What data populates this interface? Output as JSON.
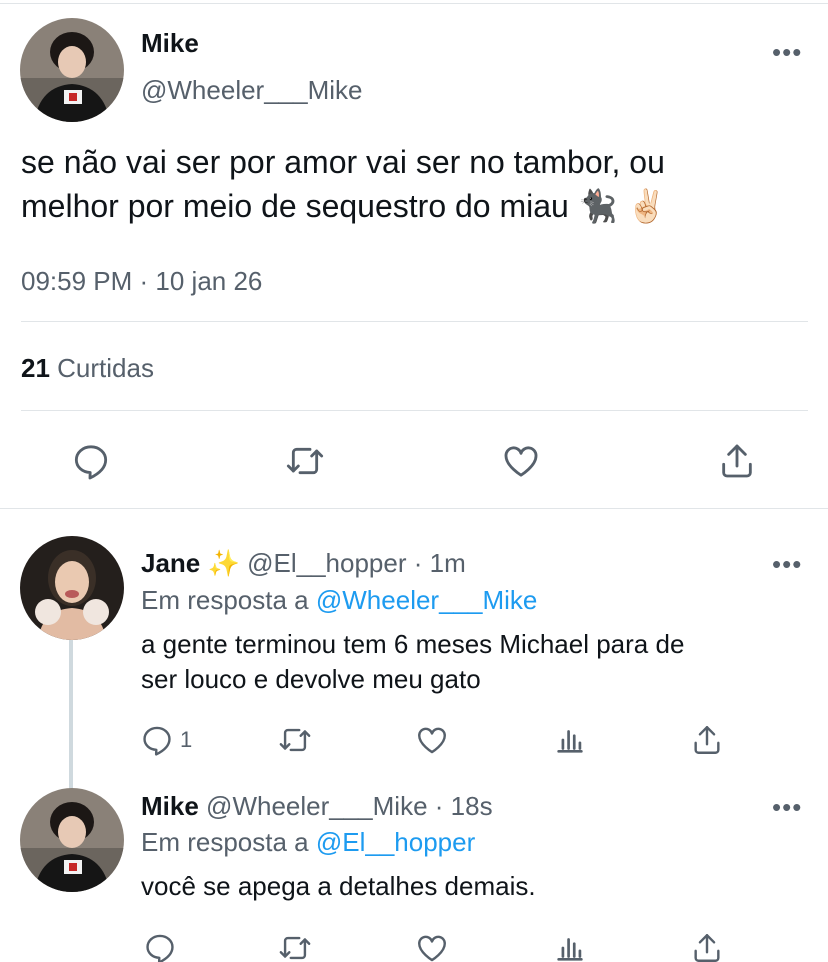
{
  "main_tweet": {
    "name": "Mike",
    "handle": "@Wheeler___Mike",
    "more": "•••",
    "text_line1": "se não vai ser por amor vai ser no tambor, ou",
    "text_line2": "melhor por meio de sequestro do miau 🐈‍⬛ ✌🏻",
    "time": "09:59 PM · 10 jan 26",
    "likes_count": "21",
    "likes_label": "Curtidas",
    "actions": [
      "reply-icon",
      "retweet-icon",
      "like-icon",
      "share-icon"
    ]
  },
  "replies": [
    {
      "name": "Jane",
      "sparkle": "✨",
      "handle": "@El__hopper",
      "sep": "·",
      "time": "1m",
      "more": "•••",
      "reply_prefix": "Em resposta a",
      "reply_to": "@Wheeler___Mike",
      "text_line1": "a gente terminou tem 6 meses Michael para de",
      "text_line2": "ser louco e devolve meu gato",
      "reply_count": "1"
    },
    {
      "name": "Mike",
      "handle": "@Wheeler___Mike",
      "sep": "·",
      "time": "18s",
      "more": "•••",
      "reply_prefix": "Em resposta a",
      "reply_to": "@El__hopper",
      "text_line1": "você se apega a detalhes demais."
    }
  ],
  "colors": {
    "text": "#0f1419",
    "secondary": "#56606b",
    "link": "#1d9bf0",
    "divider": "#e1e5e8"
  }
}
